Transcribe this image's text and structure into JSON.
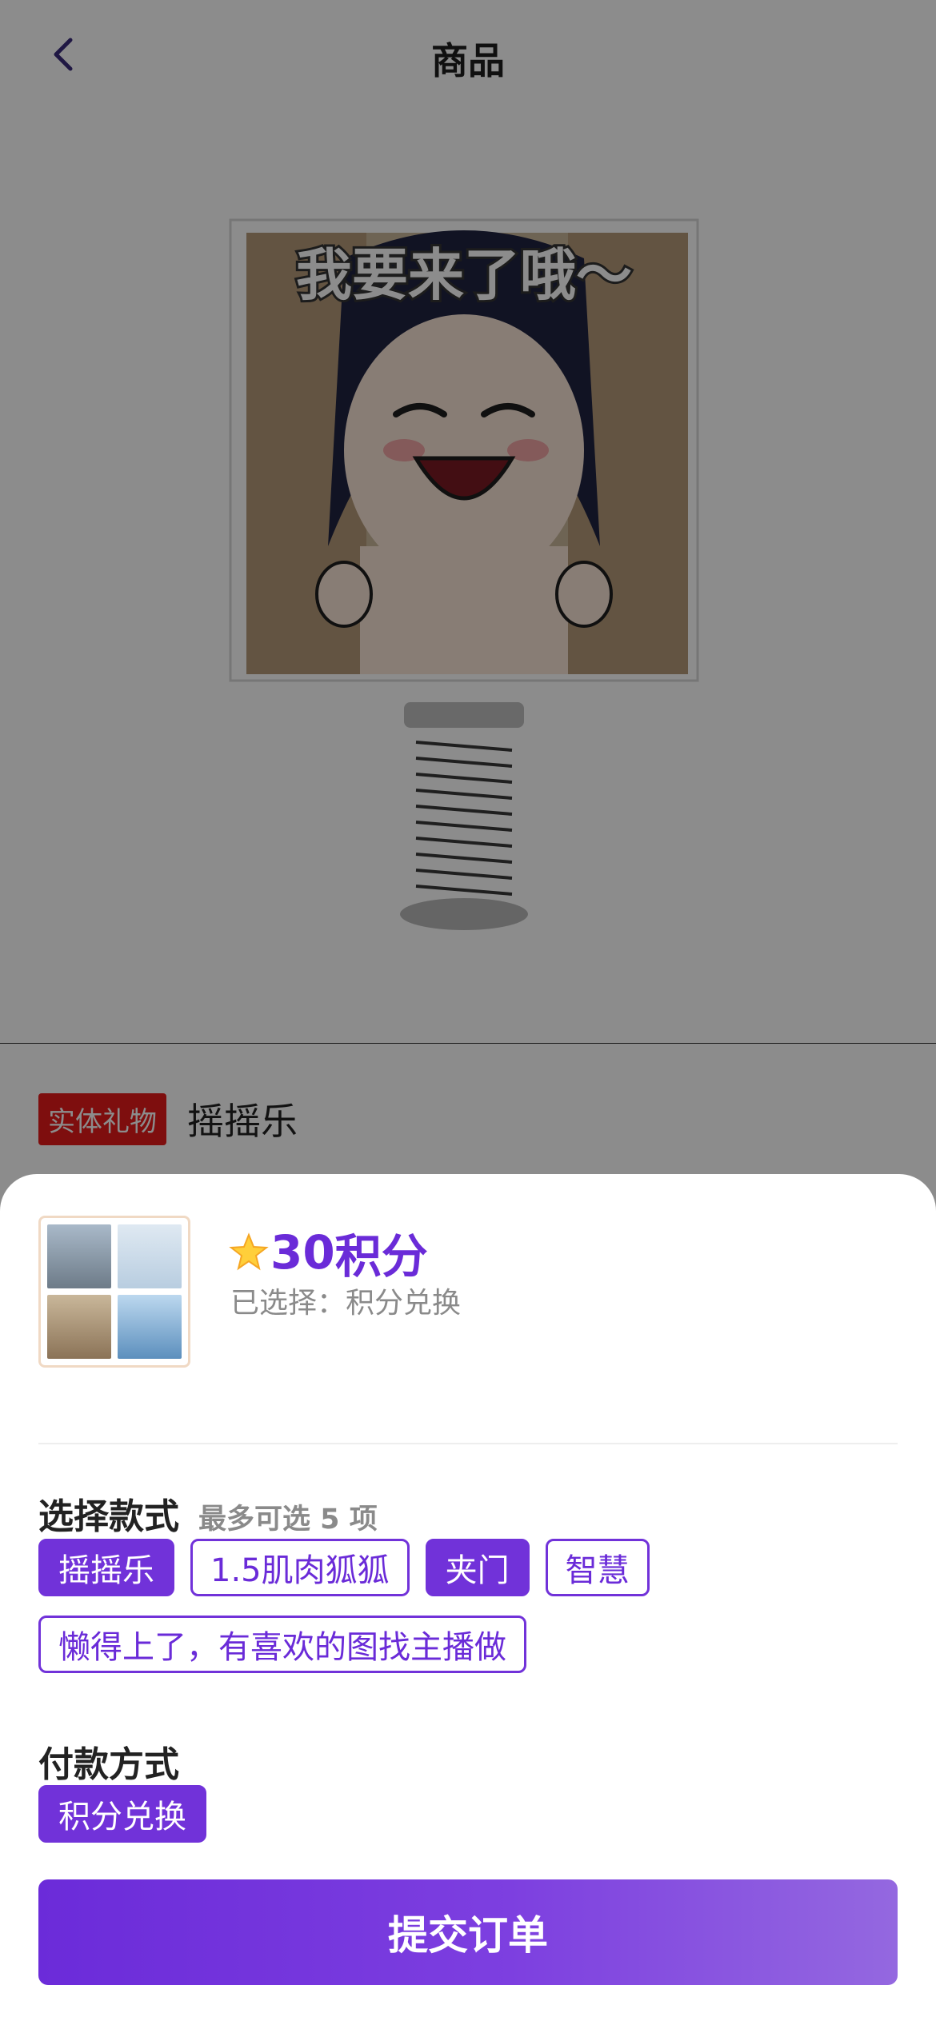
{
  "nav": {
    "title": "商品",
    "back_icon": "chevron-left-icon"
  },
  "hero": {
    "caption_on_art": "我要来了哦～",
    "dots_total": 2,
    "dots_active": 2
  },
  "product": {
    "tag": "实体礼物",
    "name": "摇摇乐"
  },
  "sheet": {
    "price": {
      "icon": "star-icon",
      "value": "30",
      "unit": "积分"
    },
    "selected_text": "已选择：积分兑换",
    "style_section": {
      "title": "选择款式",
      "hint": "最多可选 5 项",
      "options": [
        {
          "label": "摇摇乐",
          "selected": true
        },
        {
          "label": "1.5肌肉狐狐",
          "selected": false
        },
        {
          "label": "夹门",
          "selected": true
        },
        {
          "label": "智慧",
          "selected": false
        },
        {
          "label": "懒得上了，有喜欢的图找主播做",
          "selected": false
        }
      ]
    },
    "payment_section": {
      "title": "付款方式",
      "options": [
        {
          "label": "积分兑换",
          "selected": true
        }
      ]
    },
    "submit_label": "提交订单"
  },
  "colors": {
    "accent": "#7132d9",
    "tag_red": "#e61b1b"
  }
}
